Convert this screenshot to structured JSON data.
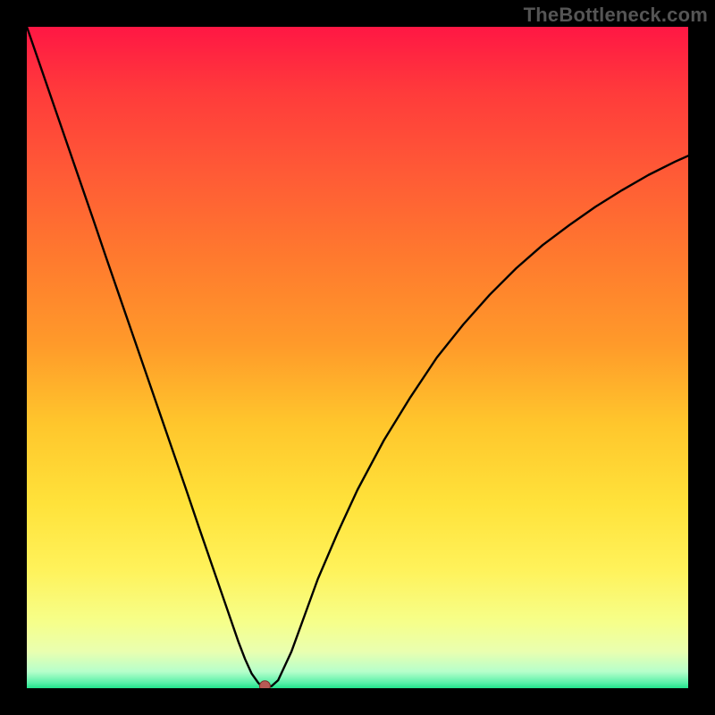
{
  "watermark": "TheBottleneck.com",
  "colors": {
    "page_bg": "#000000",
    "curve": "#000000",
    "marker_fill": "#b85a55",
    "marker_stroke": "#7a2f2b"
  },
  "gradient_stops": [
    {
      "offset": 0.0,
      "color": "#ff1744"
    },
    {
      "offset": 0.1,
      "color": "#ff3b3b"
    },
    {
      "offset": 0.22,
      "color": "#ff5a36"
    },
    {
      "offset": 0.35,
      "color": "#ff7a2e"
    },
    {
      "offset": 0.48,
      "color": "#ff9a2a"
    },
    {
      "offset": 0.6,
      "color": "#ffc62c"
    },
    {
      "offset": 0.72,
      "color": "#ffe23a"
    },
    {
      "offset": 0.82,
      "color": "#fff25a"
    },
    {
      "offset": 0.9,
      "color": "#f6ff8a"
    },
    {
      "offset": 0.945,
      "color": "#e9ffb0"
    },
    {
      "offset": 0.975,
      "color": "#b6ffcb"
    },
    {
      "offset": 0.992,
      "color": "#58f0a8"
    },
    {
      "offset": 1.0,
      "color": "#21e38c"
    }
  ],
  "chart_data": {
    "type": "line",
    "title": "",
    "xlabel": "",
    "ylabel": "",
    "xlim": [
      0,
      100
    ],
    "ylim": [
      0,
      100
    ],
    "grid": false,
    "legend": false,
    "series": [
      {
        "name": "bottleneck-curve",
        "x": [
          0.0,
          2,
          4,
          6,
          8,
          10,
          12,
          14,
          16,
          18,
          20,
          22,
          24,
          26,
          28,
          30,
          32,
          33,
          34,
          35,
          35.5,
          36,
          37,
          38,
          40,
          42,
          44,
          47,
          50,
          54,
          58,
          62,
          66,
          70,
          74,
          78,
          82,
          86,
          90,
          94,
          98,
          100
        ],
        "y": [
          100,
          94.2,
          88.4,
          82.6,
          76.8,
          71.0,
          65.1,
          59.3,
          53.5,
          47.7,
          41.9,
          36.1,
          30.3,
          24.4,
          18.6,
          12.8,
          7.0,
          4.4,
          2.2,
          0.8,
          0.3,
          0.3,
          0.3,
          1.2,
          5.5,
          11.0,
          16.5,
          23.5,
          30.0,
          37.5,
          44.0,
          50.0,
          55.0,
          59.5,
          63.5,
          67.0,
          70.0,
          72.8,
          75.3,
          77.6,
          79.6,
          80.5
        ]
      }
    ],
    "marker": {
      "x": 36,
      "y": 0.3
    },
    "annotations": []
  }
}
